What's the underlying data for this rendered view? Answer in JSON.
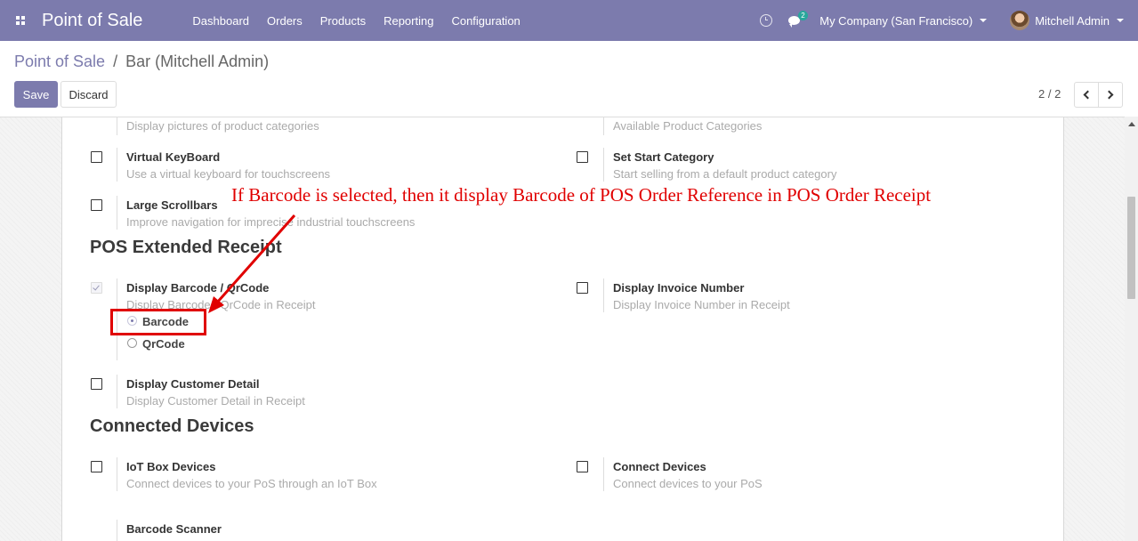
{
  "navbar": {
    "app_name": "Point of Sale",
    "menu": [
      "Dashboard",
      "Orders",
      "Products",
      "Reporting",
      "Configuration"
    ],
    "chat_count": "2",
    "company": "My Company (San Francisco)",
    "user": "Mitchell Admin"
  },
  "breadcrumb": {
    "parent": "Point of Sale",
    "separator": "/",
    "current": "Bar (Mitchell Admin)"
  },
  "buttons": {
    "save": "Save",
    "discard": "Discard"
  },
  "pager": {
    "value": "2 / 2"
  },
  "settings": {
    "category_pictures_desc": "Display pictures of product categories",
    "available_categories_desc": "Available Product Categories",
    "virtual_keyboard": {
      "title": "Virtual KeyBoard",
      "desc": "Use a virtual keyboard for touchscreens",
      "checked": false
    },
    "set_start_category": {
      "title": "Set Start Category",
      "desc": "Start selling from a default product category",
      "checked": false
    },
    "large_scrollbars": {
      "title": "Large Scrollbars",
      "desc": "Improve navigation for imprecise industrial touchscreens",
      "checked": false
    }
  },
  "pos_extended_receipt": {
    "section_title": "POS Extended Receipt",
    "display_barcode": {
      "title": "Display Barcode / QrCode",
      "desc": "Display Barcode / QrCode in Receipt",
      "checked": true,
      "options": [
        "Barcode",
        "QrCode"
      ],
      "selected": "Barcode"
    },
    "display_invoice_number": {
      "title": "Display Invoice Number",
      "desc": "Display Invoice Number in Receipt",
      "checked": false
    },
    "display_customer_detail": {
      "title": "Display Customer Detail",
      "desc": "Display Customer Detail in Receipt",
      "checked": false
    }
  },
  "connected_devices": {
    "section_title": "Connected Devices",
    "iot_box": {
      "title": "IoT Box Devices",
      "desc": "Connect devices to your PoS through an IoT Box",
      "checked": false
    },
    "connect_devices": {
      "title": "Connect Devices",
      "desc": "Connect devices to your PoS",
      "checked": false
    },
    "barcode_scanner": {
      "title": "Barcode Scanner"
    }
  },
  "annotation": {
    "text": "If Barcode is selected, then it display Barcode of POS Order Reference in POS Order Receipt",
    "color": "#e00000"
  },
  "colors": {
    "brand": "#7c7bad",
    "badge": "#28a79b"
  },
  "icons": [
    "apps-icon",
    "clock-icon",
    "chat-icon",
    "caret-down-icon",
    "chevron-left-icon",
    "chevron-right-icon"
  ]
}
